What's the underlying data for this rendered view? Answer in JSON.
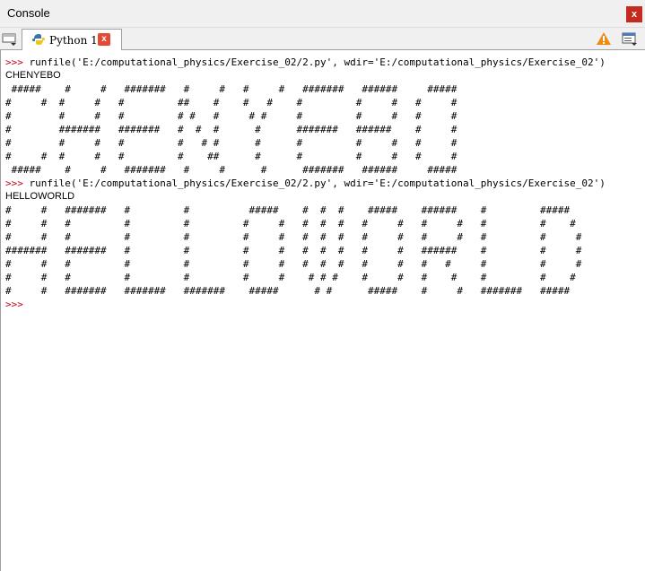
{
  "window": {
    "title": "Console",
    "close_label": "x"
  },
  "tabs": [
    {
      "label": "Python 1",
      "close_label": "x"
    }
  ],
  "toolbar": {
    "menu_icon": "tab-menu-icon",
    "warning_icon": "warning-icon",
    "options_icon": "options-icon"
  },
  "colors": {
    "prompt": "#c8001e",
    "close": "#c42b1c",
    "tab_close": "#e34a33"
  },
  "console": {
    "lines": [
      {
        "prompt": ">>>",
        "text": " runfile('E:/computational_physics/Exercise_02/2.py', wdir='E:/computational_physics/Exercise_02')"
      },
      {
        "prompt": "",
        "text": "CHENYEBO",
        "kind": "output"
      },
      {
        "prompt": "",
        "text": " #####    #     #   #######   #     #   #     #   #######   ######     #####"
      },
      {
        "prompt": "",
        "text": "#     #  #     #   #         ##    #    #   #    #         #     #   #     #"
      },
      {
        "prompt": "",
        "text": "#        #     #   #         # #   #     # #     #         #     #   #     #"
      },
      {
        "prompt": "",
        "text": "#        #######   #######   #  #  #      #      #######   ######    #     #"
      },
      {
        "prompt": "",
        "text": "#        #     #   #         #   # #      #      #         #     #   #     #"
      },
      {
        "prompt": "",
        "text": "#     #  #     #   #         #    ##      #      #         #     #   #     #"
      },
      {
        "prompt": "",
        "text": " #####    #     #   #######   #     #      #      #######   ######     #####"
      },
      {
        "prompt": ">>>",
        "text": " runfile('E:/computational_physics/Exercise_02/2.py', wdir='E:/computational_physics/Exercise_02')"
      },
      {
        "prompt": "",
        "text": "HELLOWORLD",
        "kind": "output"
      },
      {
        "prompt": "",
        "text": "#     #   #######   #         #          #####    #  #  #    #####    ######    #         #####"
      },
      {
        "prompt": "",
        "text": "#     #   #         #         #         #     #   #  #  #   #     #   #     #   #         #    #"
      },
      {
        "prompt": "",
        "text": "#     #   #         #         #         #     #   #  #  #   #     #   #     #   #         #     #"
      },
      {
        "prompt": "",
        "text": "#######   #######   #         #         #     #   #  #  #   #     #   ######    #         #     #"
      },
      {
        "prompt": "",
        "text": "#     #   #         #         #         #     #   #  #  #   #     #   #   #     #         #     #"
      },
      {
        "prompt": "",
        "text": "#     #   #         #         #         #     #    # # #    #     #   #    #    #         #    #"
      },
      {
        "prompt": "",
        "text": "#     #   #######   #######   #######    #####      # #      #####    #     #   #######   #####"
      },
      {
        "prompt": ">>>",
        "text": ""
      }
    ]
  }
}
